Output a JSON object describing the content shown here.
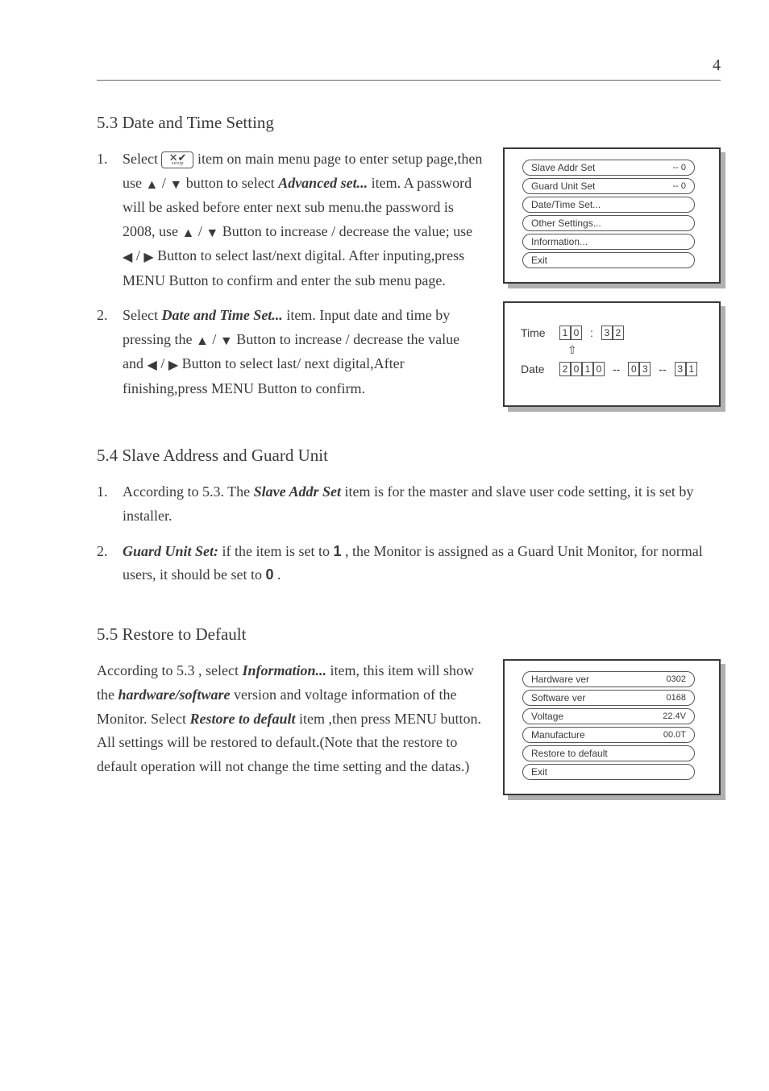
{
  "page_number": "4",
  "section53": {
    "heading": "5.3 Date and Time Setting",
    "step1": {
      "num": "1.",
      "t1": "Select ",
      "t2": " item on main menu page to enter setup page,then use ",
      "t3": " button to select ",
      "adv": "Advanced set... ",
      "t4": "item. A password will be asked before enter next sub menu.the password is 2008, use ",
      "t5": " Button to increase / decrease the value; use ",
      "t6": " Button to select last/next digital. After inputing,press MENU Button to confirm and enter the sub menu page."
    },
    "step2": {
      "num": "2.",
      "t1": "Select ",
      "dts": "Date and Time Set... ",
      "t2": "item. Input date and time by pressing  the ",
      "t3": " Button to increase / decrease the value and ",
      "t4": " Button to select last/ next digital,After finishing,press MENU Button to confirm."
    }
  },
  "panel_advanced": {
    "items": [
      {
        "label": "Slave Addr Set",
        "rhs": "--   0"
      },
      {
        "label": "Guard Unit Set",
        "rhs": "--   0"
      },
      {
        "label": "Date/Time Set...",
        "rhs": ""
      },
      {
        "label": "Other Settings...",
        "rhs": ""
      },
      {
        "label": "Information...",
        "rhs": ""
      },
      {
        "label": "Exit",
        "rhs": ""
      }
    ]
  },
  "panel_time": {
    "time_label": "Time",
    "time_digits": [
      "1",
      "0",
      "3",
      "2"
    ],
    "time_sep": ":",
    "date_label": "Date",
    "date_digits": [
      "2",
      "0",
      "1",
      "0",
      "0",
      "3",
      "3",
      "1"
    ],
    "date_sep": "--",
    "cursor": "⇧"
  },
  "section54": {
    "heading": "5.4 Slave Address and Guard Unit",
    "step1": {
      "num": "1.",
      "t1": "According to 5.3. The ",
      "sas": "Slave Addr Set ",
      "t2": "item is for the master and slave user code setting, it is set by installer."
    },
    "step2": {
      "num": "2.",
      "gus": "Guard Unit Set: ",
      "t1": "if the item is set to ",
      "one": "1",
      "t2": ", the Monitor is assigned as a Guard Unit Monitor, for normal users, it should be set to ",
      "zero": "0",
      "t3": "."
    }
  },
  "section55": {
    "heading": "5.5 Restore to Default",
    "para": {
      "t1": "According to 5.3 , select ",
      "info": "Information... ",
      "t2": "item, this item will show the ",
      "hw": "hardware/software ",
      "t3": "version and voltage information of the Monitor. Select ",
      "rtd": "Restore to default ",
      "t4": "item ,then press MENU button. All settings will be restored to default.(Note that the restore to default operation will not change the time setting and the datas.)"
    }
  },
  "panel_info": {
    "items": [
      {
        "label": "Hardware ver",
        "rhs": "0302"
      },
      {
        "label": "Software ver",
        "rhs": "0168"
      },
      {
        "label": "Voltage",
        "rhs": "22.4V"
      },
      {
        "label": "Manufacture",
        "rhs": "00.0T"
      },
      {
        "label": "Restore to default",
        "rhs": ""
      },
      {
        "label": "Exit",
        "rhs": ""
      }
    ]
  },
  "setup_icon": {
    "top": "✕✔",
    "bottom": "setup"
  },
  "arrows": {
    "up": "▲",
    "down": "▼",
    "left": "◀",
    "right": "▶",
    "slash": " / "
  }
}
